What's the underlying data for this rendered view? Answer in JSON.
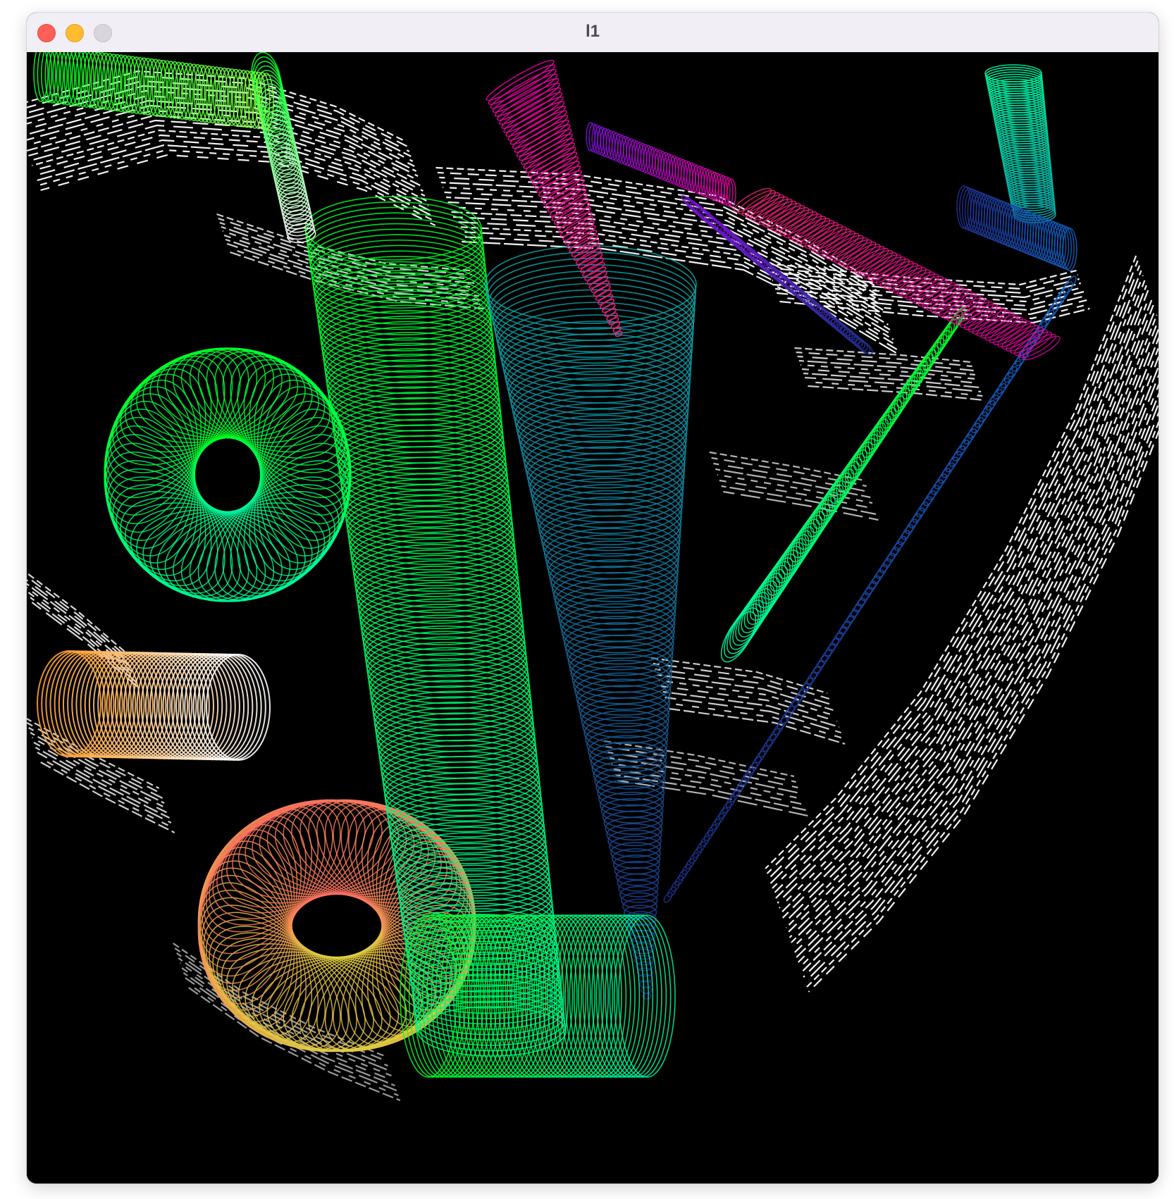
{
  "window": {
    "title": "l1",
    "controls": {
      "close": "close-button",
      "minimize": "minimize-button",
      "zoom": "zoom-button"
    }
  },
  "scene": {
    "background": "#000000",
    "palette": {
      "green": "#00ff22",
      "mint": "#00f5a0",
      "teal": "#0aa8a8",
      "blue": "#1060c0",
      "navy": "#203090",
      "magenta": "#e000a0",
      "pink": "#ff2080",
      "purple": "#7a10d0",
      "salmon": "#ff7060",
      "orange": "#ffa030",
      "white": "#ffffff"
    }
  }
}
